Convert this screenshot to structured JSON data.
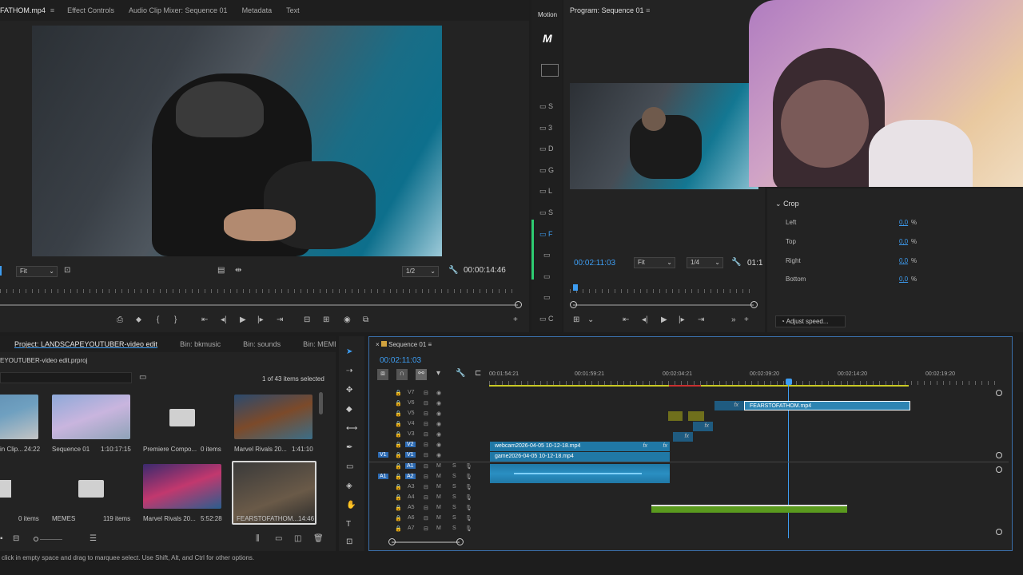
{
  "source": {
    "tabs": [
      "FATHOM.mp4",
      "Effect Controls",
      "Audio Clip Mixer: Sequence 01",
      "Metadata",
      "Text"
    ],
    "fit": "Fit",
    "resolution": "1/2",
    "timecode": "00:00:14:46"
  },
  "motion": {
    "label": "Motion"
  },
  "program": {
    "title": "Program: Sequence 01",
    "timecode": "00:02:11:03",
    "fit": "Fit",
    "resolution": "1/4",
    "right_timecode": "01:1"
  },
  "effects": {
    "crop_title": "Crop",
    "rows": [
      {
        "label": "Left",
        "value": "0,0",
        "unit": "%"
      },
      {
        "label": "Top",
        "value": "0,0",
        "unit": "%"
      },
      {
        "label": "Right",
        "value": "0,0",
        "unit": "%"
      },
      {
        "label": "Bottom",
        "value": "0,0",
        "unit": "%"
      }
    ],
    "adjust_speed": "Adjust speed..."
  },
  "project": {
    "tabs": [
      "Project: LANDSCAPEYOUTUBER-video edit",
      "Bin: bkmusic",
      "Bin: sounds",
      "Bin: MEMES"
    ],
    "file": "EYOUTUBER-video edit.prproj",
    "count": "1 of 43 items selected",
    "items": [
      {
        "name": "in Clip...",
        "meta": "24:22"
      },
      {
        "name": "Sequence 01",
        "meta": "1:10:17:15"
      },
      {
        "name": "Premiere Compo...",
        "meta": "0 items"
      },
      {
        "name": "Marvel Rivals 20...",
        "meta": "1:41:10"
      },
      {
        "name": "",
        "meta": "0 items"
      },
      {
        "name": "MEMES",
        "meta": "119 items"
      },
      {
        "name": "Marvel Rivals 20...",
        "meta": "5:52:28"
      },
      {
        "name": "FEARSTOFATHOM...",
        "meta": "14:46"
      }
    ]
  },
  "timeline": {
    "title": "Sequence 01",
    "timecode": "00:02:11:03",
    "ruler": [
      "00:01:54:21",
      "00:01:59:21",
      "00:02:04:21",
      "00:02:09:20",
      "00:02:14:20",
      "00:02:19:20"
    ],
    "video_tracks": [
      "V7",
      "V6",
      "V5",
      "V4",
      "V3",
      "V2",
      "V1"
    ],
    "audio_tracks": [
      "A1",
      "A2",
      "A3",
      "A4",
      "A5",
      "A6",
      "A7"
    ],
    "src_v": "V1",
    "src_a": "A1",
    "clips": {
      "fears": "FEARSTOFATHOM.mp4",
      "webcam": "webcam2026-04-05 10-12-18.mp4",
      "game": "game2026-04-05 10-12-18.mp4",
      "fx": "fx"
    },
    "m_label": "M",
    "s_label": "S"
  },
  "status": {
    "text": "click in empty space and drag to marquee select. Use Shift, Alt, and Ctrl for other options."
  }
}
